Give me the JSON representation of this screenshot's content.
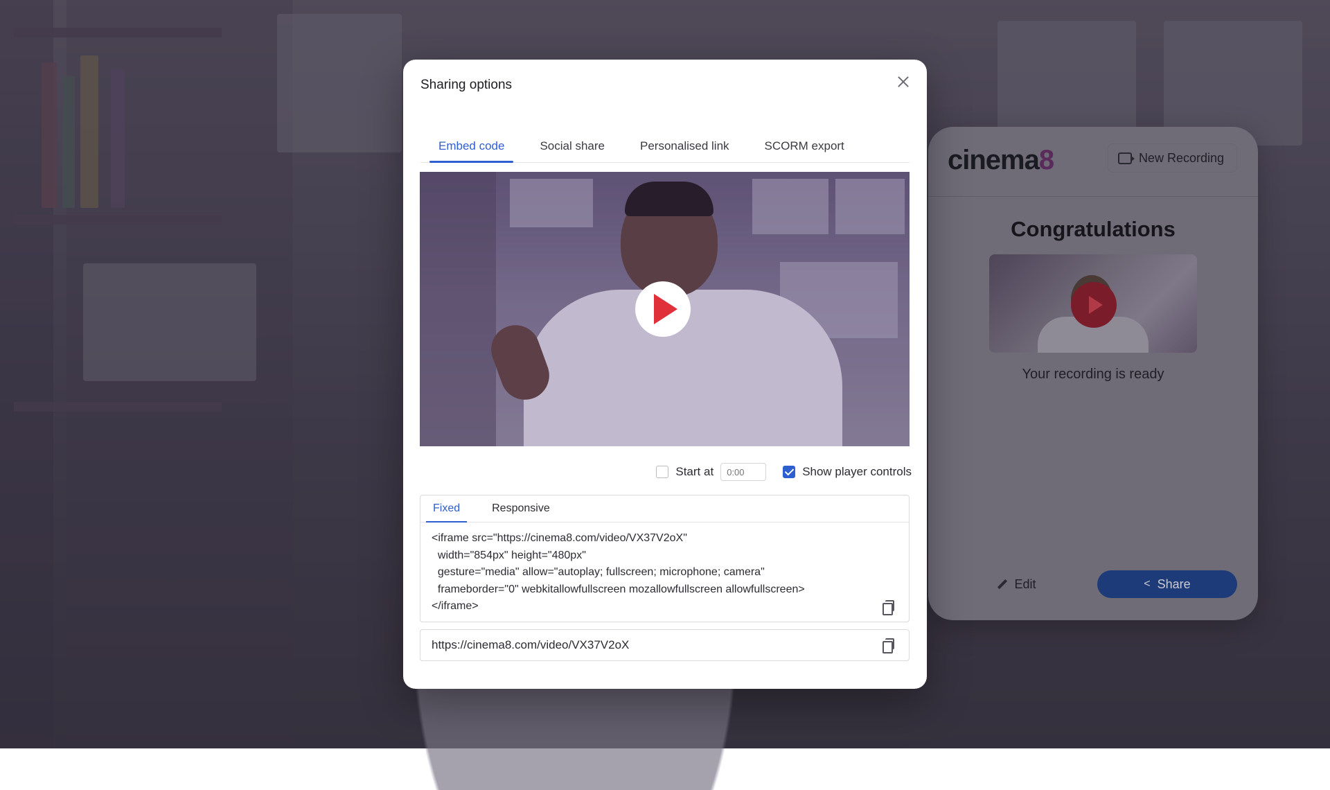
{
  "modal": {
    "title": "Sharing options",
    "tabs": [
      {
        "label": "Embed code",
        "active": true
      },
      {
        "label": "Social share",
        "active": false
      },
      {
        "label": "Personalised link",
        "active": false
      },
      {
        "label": "SCORM export",
        "active": false
      }
    ],
    "options": {
      "start_at_label": "Start at",
      "start_at_checked": false,
      "start_at_placeholder": "0:00",
      "show_controls_label": "Show player controls",
      "show_controls_checked": true
    },
    "code_tabs": [
      {
        "label": "Fixed",
        "active": true
      },
      {
        "label": "Responsive",
        "active": false
      }
    ],
    "embed_code": "<iframe src=\"https://cinema8.com/video/VX37V2oX\"\n  width=\"854px\" height=\"480px\"\n  gesture=\"media\" allow=\"autoplay; fullscreen; microphone; camera\"\n  frameborder=\"0\" webkitallowfullscreen mozallowfullscreen allowfullscreen>\n</iframe>",
    "video_url": "https://cinema8.com/video/VX37V2oX"
  },
  "card": {
    "logo_text": "cinema",
    "logo_digit": "8",
    "new_recording_label": "New Recording",
    "heading": "Congratulations",
    "subtext": "Your recording is ready",
    "edit_label": "Edit",
    "share_label": "Share"
  },
  "colors": {
    "accent": "#2d5fd0",
    "play": "#e0313a",
    "share_button": "#1d3b78"
  },
  "icons": {
    "close": "close-icon",
    "play": "play-icon",
    "copy": "copy-icon",
    "checkbox": "checkbox-icon",
    "record": "record-icon",
    "edit": "pencil-icon",
    "share": "share-icon"
  }
}
